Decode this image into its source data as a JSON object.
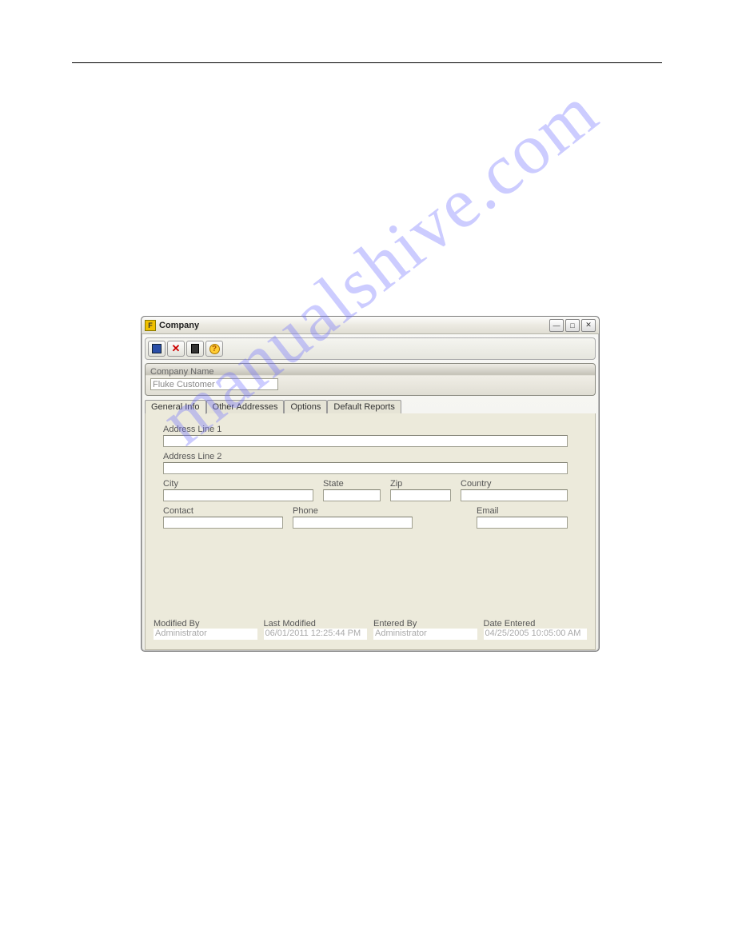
{
  "window": {
    "title": "Company"
  },
  "toolbar": {
    "save": "save",
    "delete": "delete",
    "calculator": "calc",
    "help": "?"
  },
  "company_name": {
    "label": "Company Name",
    "value": "Fluke Customer"
  },
  "tabs": {
    "general": "General Info",
    "other": "Other Addresses",
    "options": "Options",
    "reports": "Default Reports"
  },
  "fields": {
    "address1": {
      "label": "Address Line 1",
      "value": ""
    },
    "address2": {
      "label": "Address Line 2",
      "value": ""
    },
    "city": {
      "label": "City",
      "value": ""
    },
    "state": {
      "label": "State",
      "value": ""
    },
    "zip": {
      "label": "Zip",
      "value": ""
    },
    "country": {
      "label": "Country",
      "value": ""
    },
    "contact": {
      "label": "Contact",
      "value": ""
    },
    "phone": {
      "label": "Phone",
      "value": ""
    },
    "email": {
      "label": "Email",
      "value": ""
    }
  },
  "audit": {
    "modified_by": {
      "label": "Modified By",
      "value": "Administrator"
    },
    "last_modified": {
      "label": "Last Modified",
      "value": "06/01/2011 12:25:44 PM"
    },
    "entered_by": {
      "label": "Entered By",
      "value": "Administrator"
    },
    "date_entered": {
      "label": "Date Entered",
      "value": "04/25/2005 10:05:00 AM"
    }
  },
  "watermark": "manualshive.com"
}
